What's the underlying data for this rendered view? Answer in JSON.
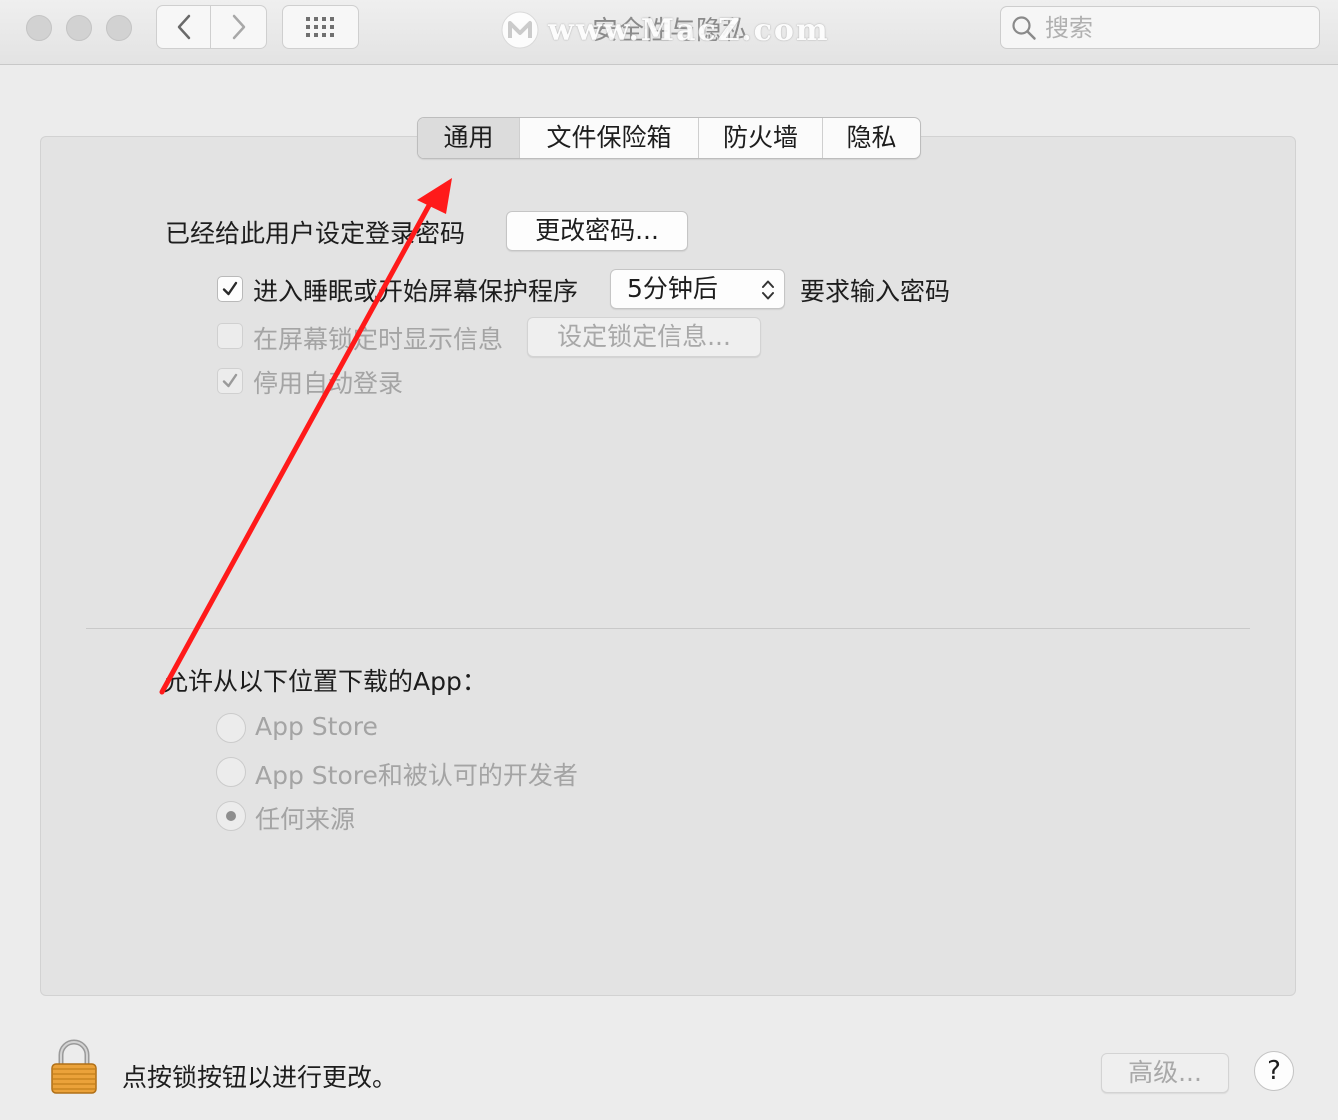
{
  "window": {
    "title": "安全性与隐私",
    "watermark": "www.MacZ.com"
  },
  "search": {
    "placeholder": "搜索"
  },
  "tabs": [
    {
      "label": "通用",
      "selected": true
    },
    {
      "label": "文件保险箱",
      "selected": false
    },
    {
      "label": "防火墙",
      "selected": false
    },
    {
      "label": "隐私",
      "selected": false
    }
  ],
  "general": {
    "password_set_label": "已经给此用户设定登录密码",
    "change_password_button": "更改密码...",
    "require_password": {
      "checked": true,
      "label": "进入睡眠或开始屏幕保护程序",
      "delay_value": "5分钟后",
      "suffix": "要求输入密码"
    },
    "show_message": {
      "checked": false,
      "label": "在屏幕锁定时显示信息",
      "button": "设定锁定信息..."
    },
    "disable_auto_login": {
      "checked": true,
      "label": "停用自动登录"
    }
  },
  "downloads": {
    "heading": "允许从以下位置下载的App：",
    "options": [
      {
        "label": "App Store",
        "selected": false
      },
      {
        "label": "App Store和被认可的开发者",
        "selected": false
      },
      {
        "label": "任何来源",
        "selected": true
      }
    ]
  },
  "footer": {
    "lock_text": "点按锁按钮以进行更改。",
    "advanced_button": "高级...",
    "help_button": "?"
  },
  "annotation": {
    "arrow_color": "#ff1a1a"
  }
}
